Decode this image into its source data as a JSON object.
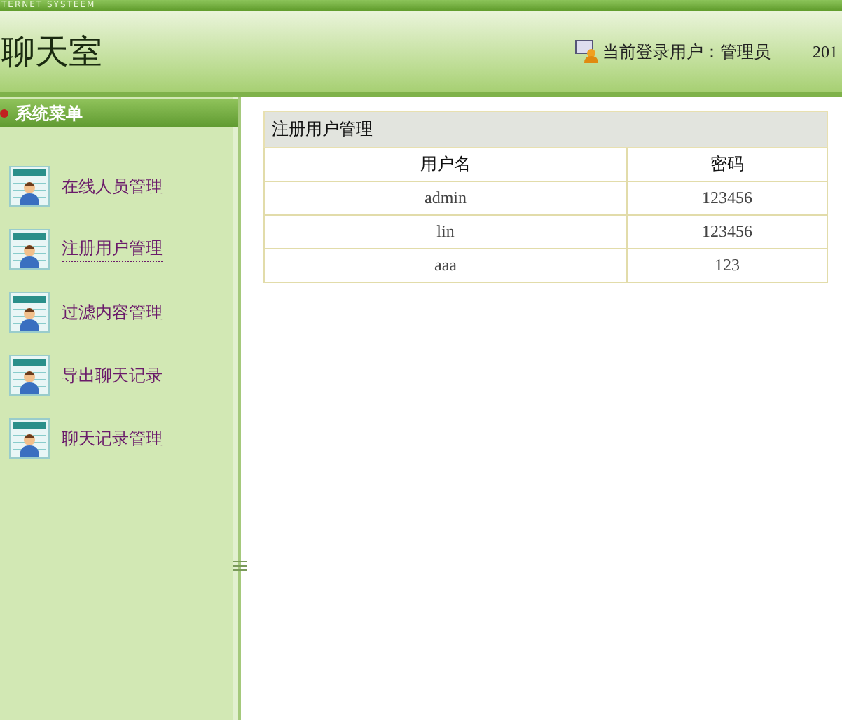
{
  "top_strip": {
    "text": "TERNET SYSTEEM"
  },
  "header": {
    "title": "聊天室",
    "user_label": "当前登录用户：管理员",
    "date": "201"
  },
  "sidebar": {
    "title": "系统菜单",
    "items": [
      {
        "label": "在线人员管理",
        "selected": false
      },
      {
        "label": "注册用户管理",
        "selected": true
      },
      {
        "label": "过滤内容管理",
        "selected": false
      },
      {
        "label": "导出聊天记录",
        "selected": false
      },
      {
        "label": "聊天记录管理",
        "selected": false
      }
    ]
  },
  "panel": {
    "title": "注册用户管理",
    "columns": [
      "用户名",
      "密码"
    ],
    "rows": [
      [
        "admin",
        "123456"
      ],
      [
        "lin",
        "123456"
      ],
      [
        "aaa",
        "123"
      ]
    ]
  }
}
